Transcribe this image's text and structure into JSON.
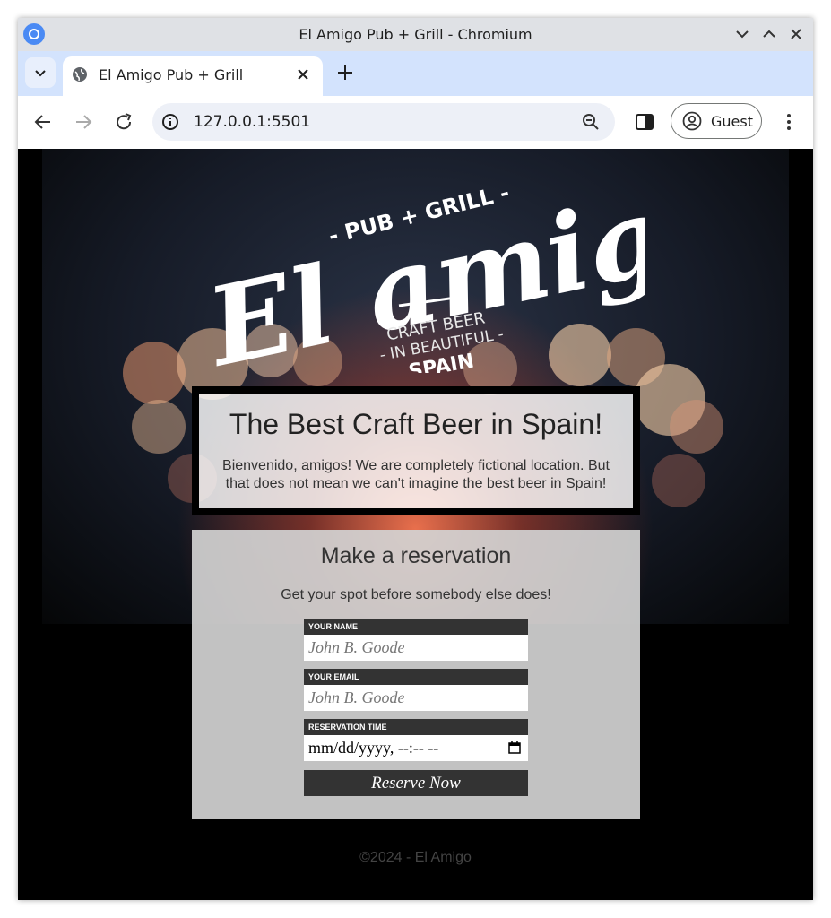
{
  "window": {
    "title": "El Amigo Pub + Grill - Chromium"
  },
  "tab": {
    "title": "El Amigo Pub + Grill"
  },
  "toolbar": {
    "url": "127.0.0.1:5501",
    "profile_label": "Guest"
  },
  "logo": {
    "line_top": "- PUB + GRILL -",
    "main": "El amigo",
    "line1": "CRAFT BEER",
    "line2": "- IN BEAUTIFUL -",
    "line3": "SPAIN"
  },
  "hero": {
    "title": "The Best Craft Beer in Spain!",
    "text": "Bienvenido, amigos! We are completely fictional location. But that does not mean we can't imagine the best beer in Spain!"
  },
  "reservation": {
    "title": "Make a reservation",
    "subtitle": "Get your spot before somebody else does!",
    "name_label": "YOUR NAME",
    "name_placeholder": "John B. Goode",
    "email_label": "YOUR EMAIL",
    "email_placeholder": "John B. Goode",
    "time_label": "RESERVATION TIME",
    "time_placeholder": "mm/dd/yyyy, --:-- --",
    "button": "Reserve Now"
  },
  "footer": {
    "text": "©2024 - El Amigo"
  }
}
